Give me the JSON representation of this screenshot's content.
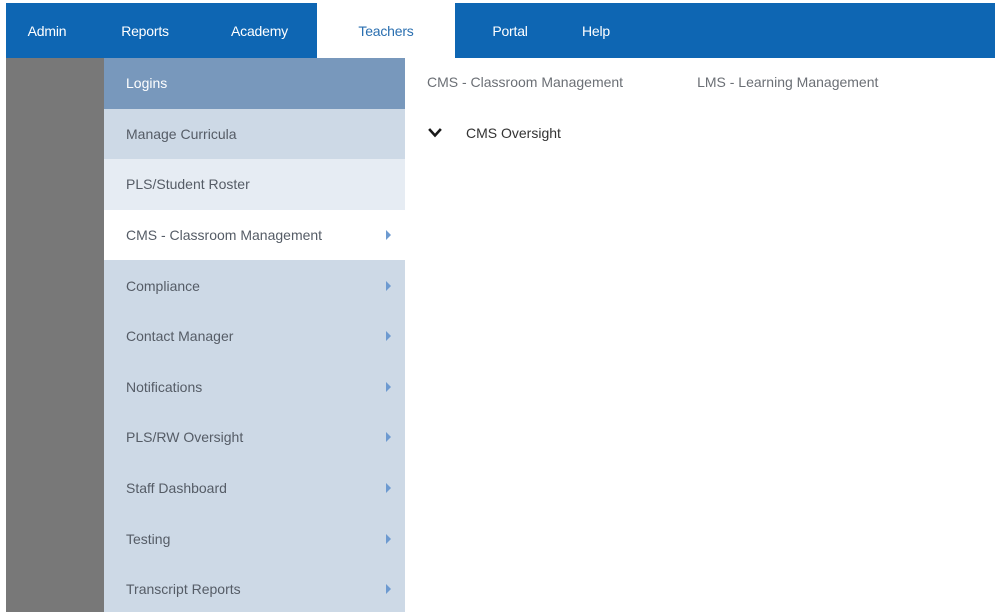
{
  "topnav": {
    "tabs": [
      {
        "label": "Admin"
      },
      {
        "label": "Reports"
      },
      {
        "label": "Academy"
      },
      {
        "label": "Teachers"
      },
      {
        "label": "Portal"
      },
      {
        "label": "Help"
      }
    ],
    "active_tab": "Teachers"
  },
  "sidebar": {
    "items": [
      {
        "label": "Logins"
      },
      {
        "label": "Manage Curricula"
      },
      {
        "label": "PLS/Student Roster"
      },
      {
        "label": "CMS - Classroom Management"
      },
      {
        "label": "Compliance"
      },
      {
        "label": "Contact Manager"
      },
      {
        "label": "Notifications"
      },
      {
        "label": "PLS/RW Oversight"
      },
      {
        "label": "Staff Dashboard"
      },
      {
        "label": "Testing"
      },
      {
        "label": "Transcript Reports"
      }
    ]
  },
  "content": {
    "tabs": [
      {
        "label": "CMS - Classroom Management"
      },
      {
        "label": "LMS - Learning Management"
      }
    ],
    "section": {
      "label": "CMS Oversight",
      "icon": "chevron-down-icon"
    }
  },
  "colors": {
    "nav_blue": "#0e66b3",
    "active_tab_text": "#2a6fb0",
    "sidebar_bg": "#cdd9e6",
    "sidebar_active": "#7898bc",
    "dark_strip": "#787878"
  }
}
